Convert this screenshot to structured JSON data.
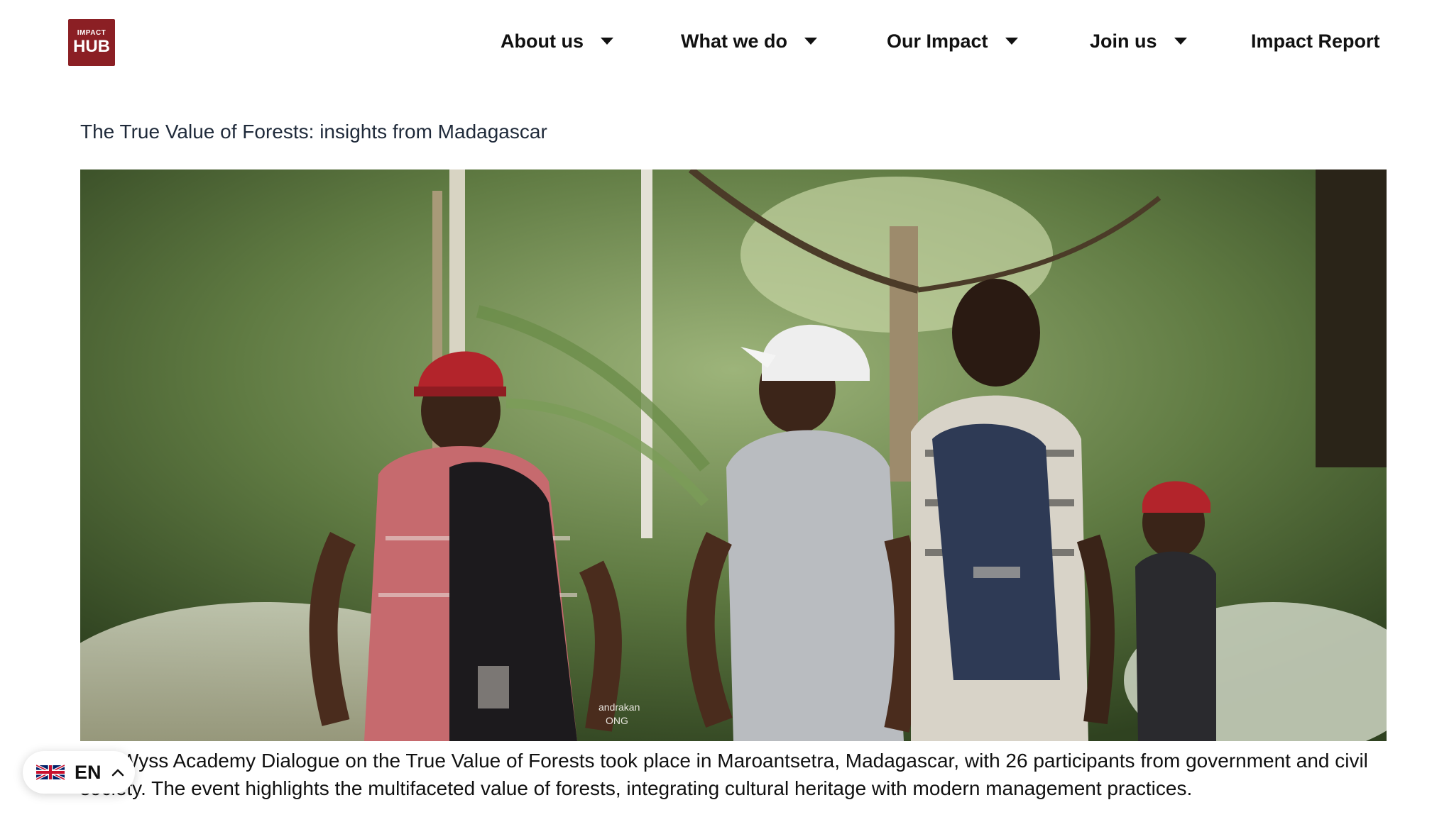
{
  "header": {
    "logo": {
      "line1": "IMPACT",
      "line2": "HUB",
      "color": "#8b1f24"
    },
    "nav": [
      {
        "label": "About us",
        "has_dropdown": true
      },
      {
        "label": "What we do",
        "has_dropdown": true
      },
      {
        "label": "Our Impact",
        "has_dropdown": true
      },
      {
        "label": "Join us",
        "has_dropdown": true
      },
      {
        "label": "Impact Report",
        "has_dropdown": false
      }
    ]
  },
  "article": {
    "title": "The True Value of Forests: insights from Madagascar",
    "hero_image": {
      "alt": "",
      "details": {
        "backpack_text_1": "andrakan",
        "backpack_text_2": "ONG"
      }
    },
    "caption": "The Wyss Academy Dialogue on the True Value of Forests took place in Maroantsetra, Madagascar, with 26 participants from government and civil society. The event highlights the multifaceted value of forests, integrating cultural heritage with modern management practices."
  },
  "language_switcher": {
    "code": "EN",
    "flag_icon": "uk-flag-icon",
    "chevron_icon": "chevron-up-icon"
  }
}
